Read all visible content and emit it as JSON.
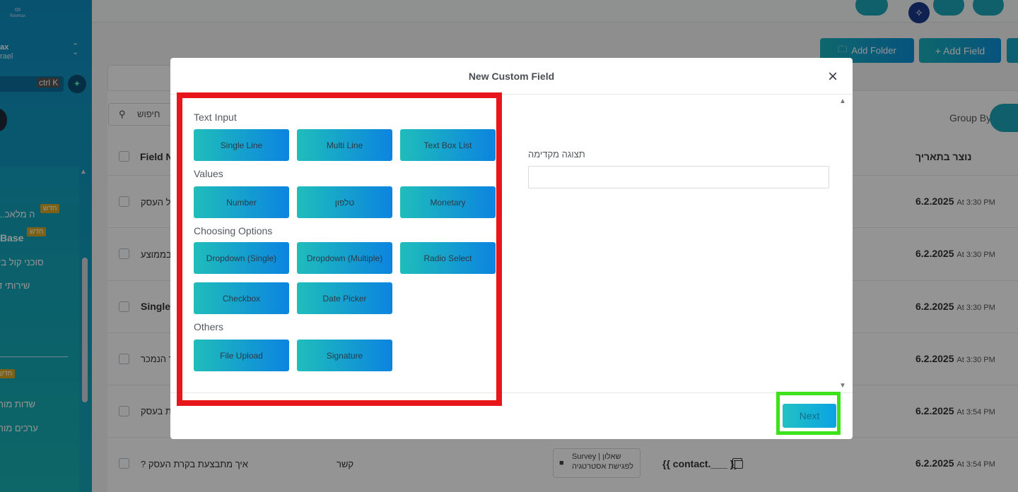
{
  "sidebar": {
    "logo_text": "flowmax",
    "account_name": "ax",
    "account_sub": "rael",
    "search_shortcut": "ctrl K",
    "items": [
      {
        "label": "...ה מלאכ",
        "badge": "חדש"
      },
      {
        "label": "Base",
        "badge": "חדש"
      },
      {
        "label": "סוכני קול בי"
      },
      {
        "label": "שירותי ד"
      },
      {
        "label": "",
        "badge": "חדש"
      },
      {
        "label": "שדות מות"
      },
      {
        "label": "ערכים מות"
      }
    ]
  },
  "toolbar": {
    "add_folder": "Add Folder",
    "add_field": "+ Add Field"
  },
  "table": {
    "search_placeholder": "חיפוש",
    "group_by": "Group By",
    "col_field_name": "Field N",
    "col_created": "נוצר בתאריך",
    "rows": [
      {
        "name": "ל העסק",
        "date": "6.2.2025",
        "time": "At 3:30 PM"
      },
      {
        "name": "בממוצע",
        "date": "6.2.2025",
        "time": "At 3:30 PM"
      },
      {
        "name": "Single l",
        "date": "6.2.2025",
        "time": "At 3:30 PM"
      },
      {
        "name": "ר הנמכר",
        "date": "6.2.2025",
        "time": "At 3:30 PM"
      },
      {
        "name": "ת בעסק",
        "date": "6.2.2025",
        "time": "At 3:54 PM"
      },
      {
        "name": "? איך מתבצעת בקרת העסק",
        "date": "6.2.2025",
        "time": "At 3:54 PM",
        "type": "קשר",
        "folder": "Survey | שאלון לפגישת אסטרטגיה",
        "merge": "{{ contact.___ }}"
      }
    ]
  },
  "modal": {
    "title": "New Custom Field",
    "preview_label": "תצוגה מקדימה",
    "next_label": "Next",
    "sections": [
      {
        "title": "Text Input",
        "buttons": [
          "Single Line",
          "Multi Line",
          "Text Box List"
        ]
      },
      {
        "title": "Values",
        "buttons": [
          "Number",
          "טלפון",
          "Monetary"
        ]
      },
      {
        "title": "Choosing Options",
        "buttons": [
          "Dropdown (Single)",
          "Dropdown (Multiple)",
          "Radio Select",
          "Checkbox",
          "Date Picker"
        ]
      },
      {
        "title": "Others",
        "buttons": [
          "File Upload",
          "Signature"
        ]
      }
    ]
  },
  "colors": {
    "accent_gradient_start": "#1fbdbb",
    "accent_gradient_end": "#0c84e0",
    "highlight_red": "#e8161b",
    "highlight_green": "#3ce21a"
  },
  "icons": {
    "close": "close-icon",
    "search": "search-icon",
    "folder": "folder-icon",
    "copy": "copy-icon",
    "bell": "bell-icon",
    "megaphone": "megaphone-icon"
  }
}
